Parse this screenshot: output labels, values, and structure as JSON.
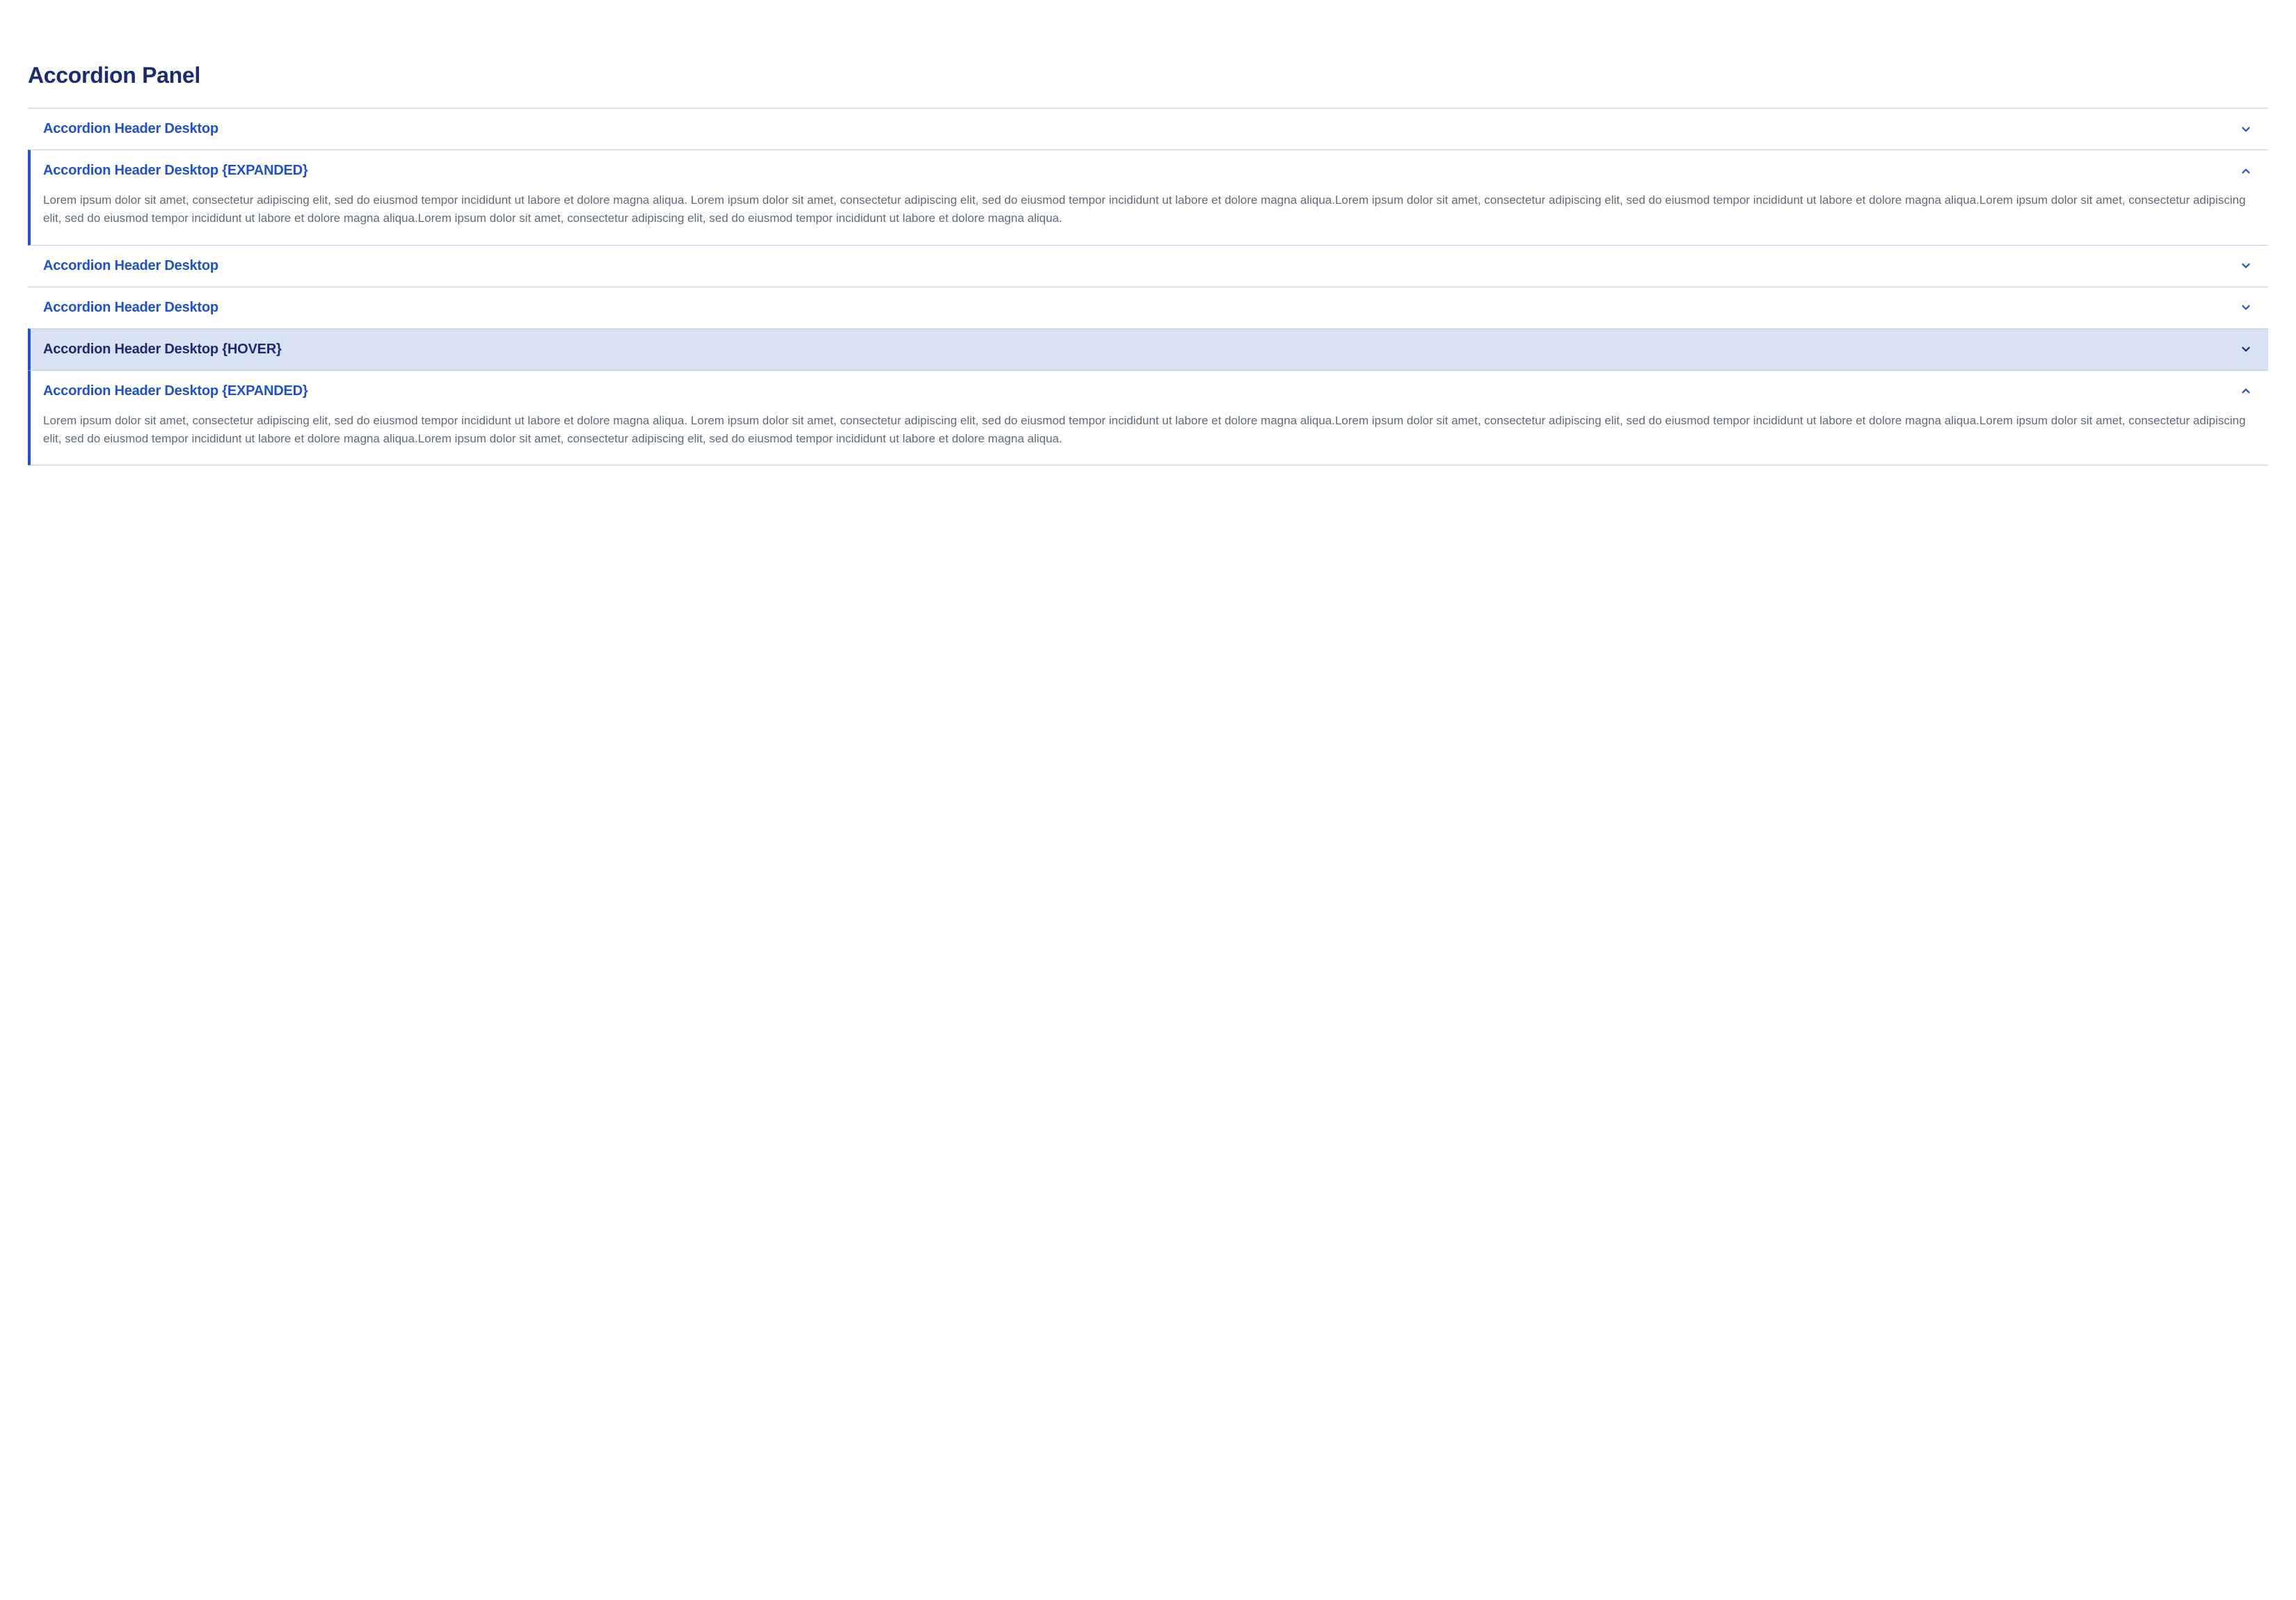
{
  "panel_title": "Accordion Panel",
  "colors": {
    "header_text": "#1d4fd7",
    "header_text_hover": "#1a2a73",
    "panel_title": "#1a2a73",
    "hover_bg": "#d9e2f3",
    "accent_border": "#1d4fd7",
    "divider": "#c3cdee",
    "body_text": "#5f6b7a"
  },
  "items": [
    {
      "title": "Accordion Header Desktop",
      "state": "collapsed",
      "body": ""
    },
    {
      "title": "Accordion Header Desktop {EXPANDED}",
      "state": "expanded",
      "body": "Lorem ipsum dolor sit amet, consectetur adipiscing elit, sed do eiusmod tempor incididunt ut labore et dolore magna aliqua. Lorem ipsum dolor sit amet, consectetur adipiscing elit, sed do eiusmod tempor incididunt ut labore et dolore magna aliqua.Lorem ipsum dolor sit amet, consectetur adipiscing elit, sed do eiusmod tempor incididunt ut labore et dolore magna aliqua.Lorem ipsum dolor sit amet, consectetur adipiscing elit, sed do eiusmod tempor incididunt ut labore et dolore magna aliqua.Lorem ipsum dolor sit amet, consectetur adipiscing elit, sed do eiusmod tempor incididunt ut labore et dolore magna aliqua."
    },
    {
      "title": "Accordion Header Desktop",
      "state": "collapsed",
      "body": ""
    },
    {
      "title": "Accordion Header Desktop",
      "state": "collapsed",
      "body": ""
    },
    {
      "title": "Accordion Header Desktop {HOVER}",
      "state": "hover",
      "body": ""
    },
    {
      "title": "Accordion Header Desktop {EXPANDED}",
      "state": "expanded",
      "body": "Lorem ipsum dolor sit amet, consectetur adipiscing elit, sed do eiusmod tempor incididunt ut labore et dolore magna aliqua. Lorem ipsum dolor sit amet, consectetur adipiscing elit, sed do eiusmod tempor incididunt ut labore et dolore magna aliqua.Lorem ipsum dolor sit amet, consectetur adipiscing elit, sed do eiusmod tempor incididunt ut labore et dolore magna aliqua.Lorem ipsum dolor sit amet, consectetur adipiscing elit, sed do eiusmod tempor incididunt ut labore et dolore magna aliqua.Lorem ipsum dolor sit amet, consectetur adipiscing elit, sed do eiusmod tempor incididunt ut labore et dolore magna aliqua."
    }
  ]
}
